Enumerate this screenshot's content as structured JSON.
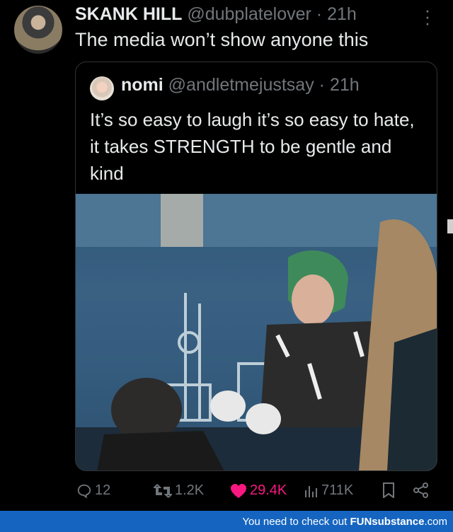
{
  "tweet": {
    "author_name": "SKANK HILL",
    "author_handle": "@dubplatelover",
    "separator": "·",
    "time": "21h",
    "text": "The media won’t show anyone this"
  },
  "quote": {
    "author_name": "nomi",
    "author_handle": "@andletmejustsay",
    "separator": "·",
    "time": "21h",
    "text": "It’s so easy to laugh it’s so easy to hate, it takes STRENGTH to be gentle and kind"
  },
  "actions": {
    "replies": "12",
    "reposts": "1.2K",
    "likes": "29.4K",
    "views": "711K"
  },
  "footer": {
    "prefix": "You need to check out",
    "brand": "FUNsubstance",
    "suffix": ".com"
  },
  "colors": {
    "background": "#000000",
    "text": "#e7e9ea",
    "muted": "#71767b",
    "like": "#f91880",
    "footer": "#1565c0"
  }
}
